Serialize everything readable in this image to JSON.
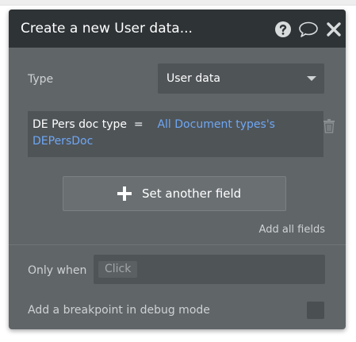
{
  "dialog": {
    "title": "Create a new User data...",
    "icons": [
      "help-icon",
      "comment-icon",
      "close-icon"
    ]
  },
  "type_row": {
    "label": "Type",
    "selected": "User data"
  },
  "field": {
    "key": "DE Pers doc type",
    "operator": "=",
    "value_line1": "All Document types's",
    "value_line2": "DEPersDoc"
  },
  "actions": {
    "set_another_field": "Set another field",
    "add_all_fields": "Add all fields"
  },
  "condition": {
    "label": "Only when",
    "placeholder_chip": "Click"
  },
  "debug": {
    "label": "Add a breakpoint in debug mode",
    "checked": false
  },
  "colors": {
    "header_bg": "#2e3336",
    "panel_bg": "#606568",
    "field_bg": "#4f5457",
    "link_value": "#6ea7f5"
  }
}
